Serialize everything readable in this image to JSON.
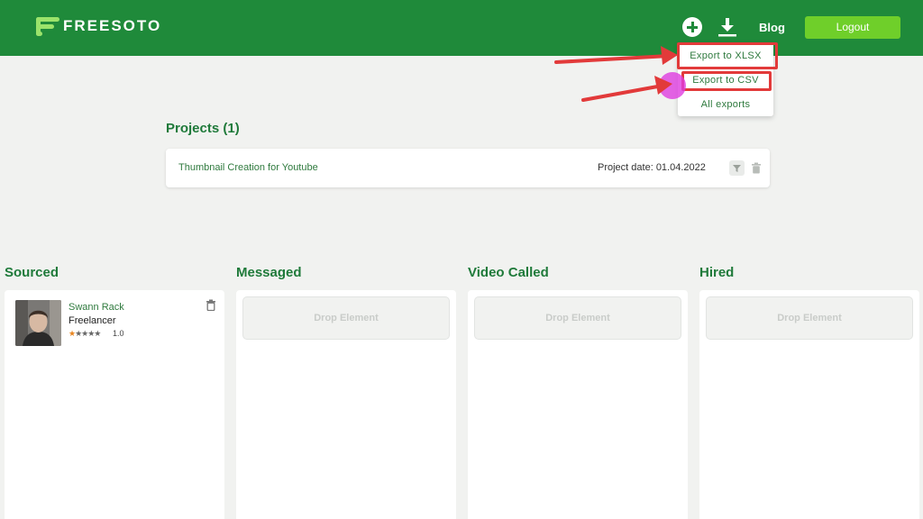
{
  "header": {
    "logo_text": "FREESOTO",
    "blog_label": "Blog",
    "logout_label": "Logout",
    "brand_color": "#1f8a3a",
    "logout_color": "#6fcf2a"
  },
  "export_menu": {
    "items": [
      {
        "label": "Export to XLSX"
      },
      {
        "label": "Export to CSV"
      },
      {
        "label": "All exports"
      }
    ]
  },
  "projects": {
    "title": "Projects (1)",
    "list": [
      {
        "name": "Thumbnail Creation for Youtube",
        "date": "Project date: 01.04.2022"
      }
    ]
  },
  "columns": [
    {
      "title": "Sourced"
    },
    {
      "title": "Messaged",
      "drop_text": "Drop Element"
    },
    {
      "title": "Video Called",
      "drop_text": "Drop Element"
    },
    {
      "title": "Hired",
      "drop_text": "Drop Element"
    }
  ],
  "candidate": {
    "name": "Swann Rack",
    "role": "Freelancer",
    "stars": "★★★★★",
    "rating": "1.0"
  },
  "icons": {
    "add": "plus-circle-icon",
    "export": "download-icon",
    "filter": "filter-icon",
    "delete": "trash-icon"
  },
  "annotation_color": "#e23a3a"
}
